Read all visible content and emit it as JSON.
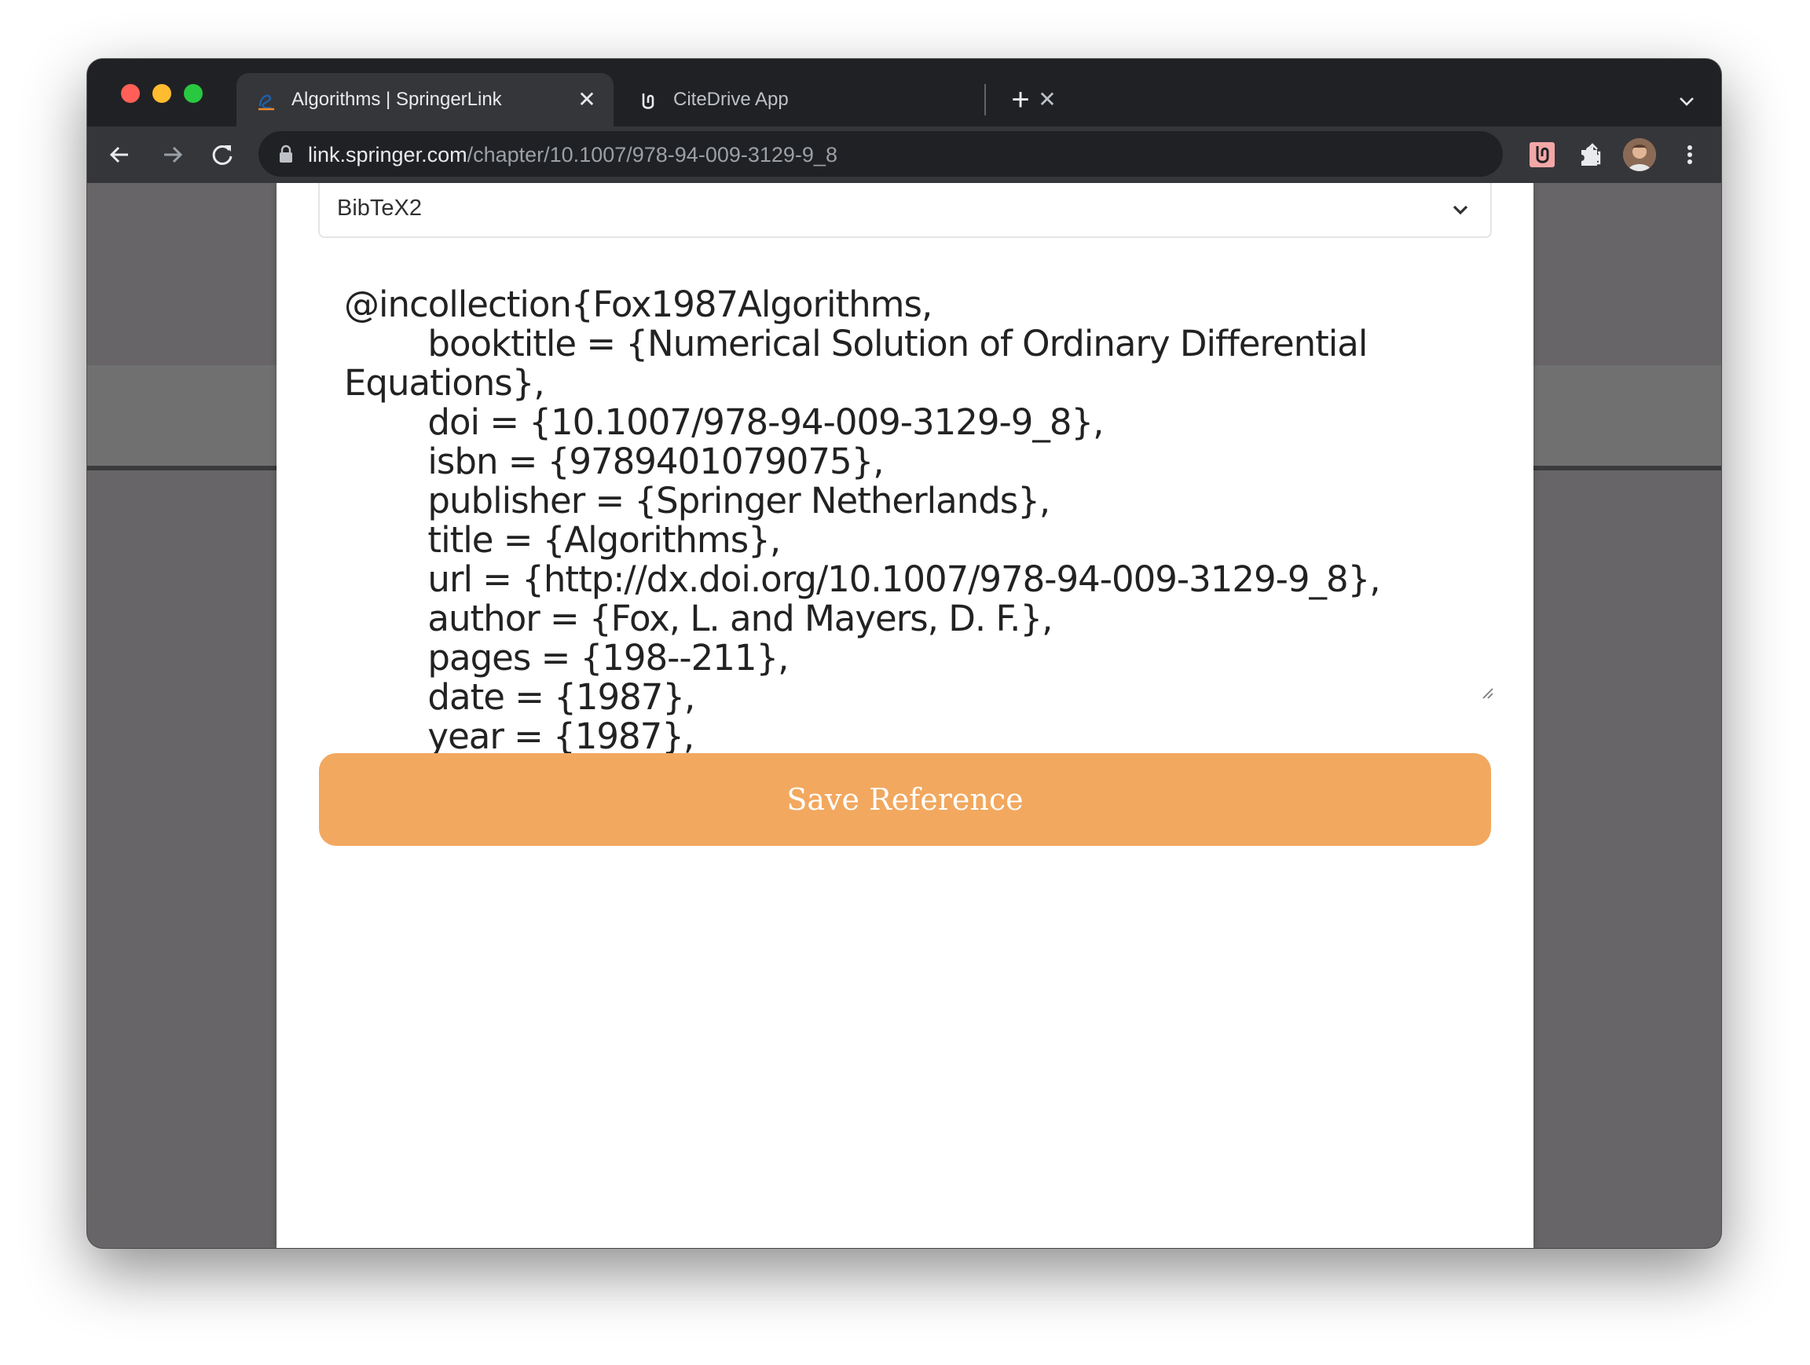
{
  "browser": {
    "tabs": [
      {
        "title": "Algorithms | SpringerLink",
        "active": true,
        "favicon": "springer-favicon-icon"
      },
      {
        "title": "CiteDrive App",
        "active": false,
        "favicon": "citedrive-favicon-icon"
      }
    ],
    "tab_close_glyph": "✕",
    "new_tab_glyph": "+",
    "url": {
      "host": "link.springer.com",
      "path": "/chapter/10.1007/978-94-009-3129-9_8"
    },
    "icons": [
      "back-icon",
      "forward-icon",
      "reload-icon",
      "lock-icon",
      "key-icon",
      "share-icon",
      "star-icon",
      "citedrive-extension-icon",
      "puzzle-icon",
      "avatar",
      "kebab-menu-icon"
    ]
  },
  "form": {
    "format_select": {
      "value": "BibTeX2"
    },
    "bibtex_text": "@incollection{Fox1987Algorithms,\n        booktitle = {Numerical Solution of Ordinary Differential\nEquations},\n        doi = {10.1007/978-94-009-3129-9_8},\n        isbn = {9789401079075},\n        publisher = {Springer Netherlands},\n        title = {Algorithms},\n        url = {http://dx.doi.org/10.1007/978-94-009-3129-9_8},\n        author = {Fox, L. and Mayers, D. F.},\n        pages = {198--211},\n        date = {1987},\n        year = {1987},\n}",
    "save_label": "Save Reference"
  },
  "colors": {
    "accent": "#f2a85f",
    "chrome_dark": "#202124",
    "chrome_toolbar": "#35363a",
    "backdrop": "#676568"
  }
}
